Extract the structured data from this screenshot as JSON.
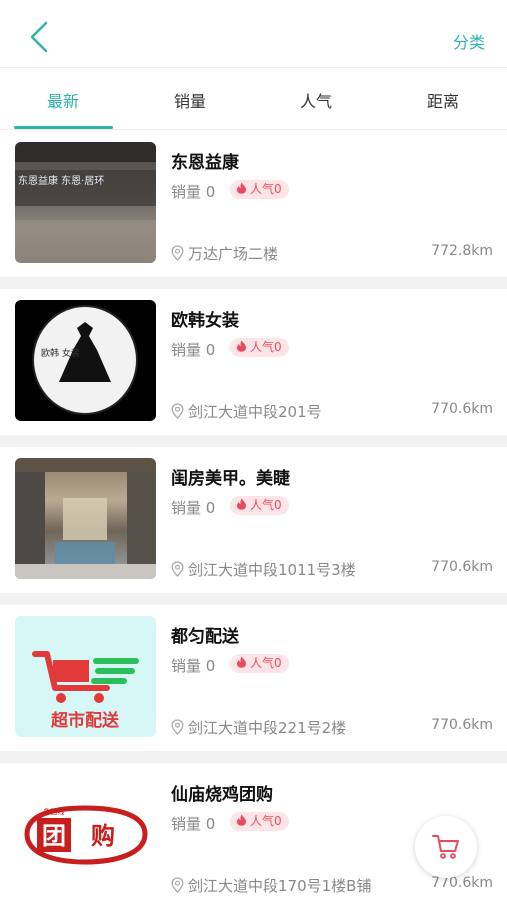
{
  "header": {
    "back_icon": "chevron-left-icon",
    "right_label": "分类",
    "accent": "#2bb5a8"
  },
  "tabs": [
    {
      "label": "最新",
      "active": true
    },
    {
      "label": "销量",
      "active": false
    },
    {
      "label": "人气",
      "active": false
    },
    {
      "label": "距离",
      "active": false
    }
  ],
  "shops": [
    {
      "name": "东恩益康",
      "sales": "销量 0",
      "hot": "人气0",
      "address": "万达广场二楼",
      "distance": "772.8km",
      "thumb_text": "东恩益康  东恩·居环"
    },
    {
      "name": "欧韩女装",
      "sales": "销量 0",
      "hot": "人气0",
      "address": "剑江大道中段201号",
      "distance": "770.6km",
      "thumb_text": "欧韩  女装"
    },
    {
      "name": "闺房美甲。美睫",
      "sales": "销量 0",
      "hot": "人气0",
      "address": "剑江大道中段1011号3楼",
      "distance": "770.6km"
    },
    {
      "name": "都匀配送",
      "sales": "销量 0",
      "hot": "人气0",
      "address": "剑江大道中段221号2楼",
      "distance": "770.6km",
      "thumb_text": "超市配送"
    },
    {
      "name": "仙庙烧鸡团购",
      "sales": "销量 0",
      "hot": "人气0",
      "address": "剑江大道中段170号1楼B铺",
      "distance": "770.6km",
      "thumb_text": "团购",
      "thumb_badge": "象西线"
    }
  ],
  "fab_icon": "cart-icon",
  "colors": {
    "hot_bg": "#fde5e7",
    "hot_text": "#e84b5f",
    "separator": "#f2f2f2"
  }
}
